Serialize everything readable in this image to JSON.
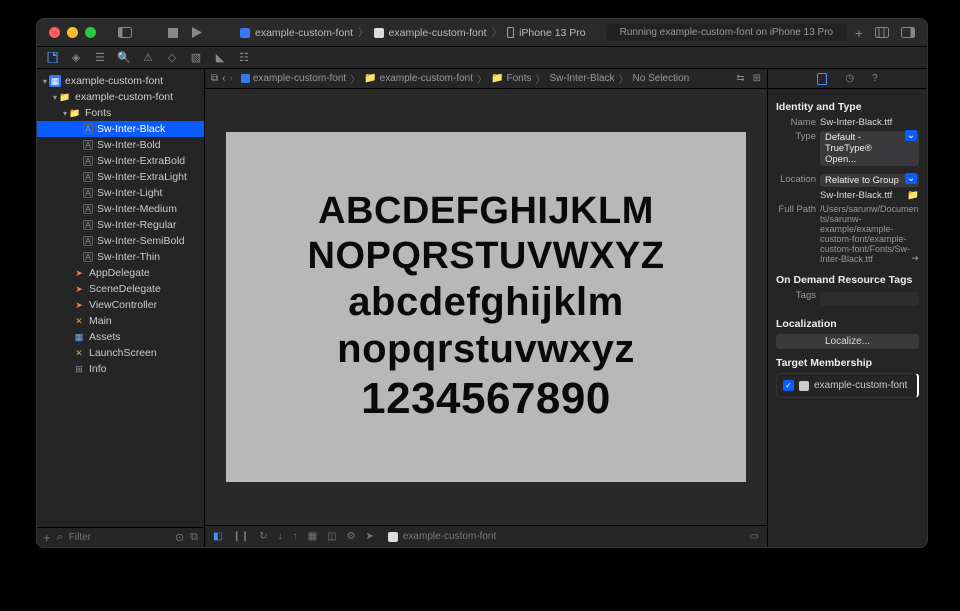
{
  "titlebar": {
    "scheme": "example-custom-font",
    "target_app": "example-custom-font",
    "device": "iPhone 13 Pro",
    "status": "Running example-custom-font on iPhone 13 Pro"
  },
  "navigator": {
    "project": "example-custom-font",
    "group": "example-custom-font",
    "fonts_folder": "Fonts",
    "fonts": [
      "Sw-Inter-Black",
      "Sw-Inter-Bold",
      "Sw-Inter-ExtraBold",
      "Sw-Inter-ExtraLight",
      "Sw-Inter-Light",
      "Sw-Inter-Medium",
      "Sw-Inter-Regular",
      "Sw-Inter-SemiBold",
      "Sw-Inter-Thin"
    ],
    "others": [
      {
        "label": "AppDelegate",
        "icon": "swift"
      },
      {
        "label": "SceneDelegate",
        "icon": "swift"
      },
      {
        "label": "ViewController",
        "icon": "swift"
      },
      {
        "label": "Main",
        "icon": "story"
      },
      {
        "label": "Assets",
        "icon": "asset"
      },
      {
        "label": "LaunchScreen",
        "icon": "story"
      },
      {
        "label": "Info",
        "icon": "plist"
      }
    ],
    "selected": "Sw-Inter-Black",
    "filter_placeholder": "Filter"
  },
  "jumpbar": {
    "items": [
      "example-custom-font",
      "example-custom-font",
      "Fonts",
      "Sw-Inter-Black",
      "No Selection"
    ]
  },
  "preview": {
    "l1": "ABCDEFGHIJKLM",
    "l2": "NOPQRSTUVWXYZ",
    "l3": "abcdefghijklm",
    "l4": "nopqrstuvwxyz",
    "l5": "1234567890"
  },
  "debugbar": {
    "process": "example-custom-font"
  },
  "inspector": {
    "identity_header": "Identity and Type",
    "name_label": "Name",
    "name_value": "Sw-Inter-Black.ttf",
    "type_label": "Type",
    "type_value": "Default - TrueType® Open...",
    "location_label": "Location",
    "location_value": "Relative to Group",
    "location_file": "Sw-Inter-Black.ttf",
    "fullpath_label": "Full Path",
    "fullpath_value": "/Users/sarunw/Documents/sarunw-example/example-custom-font/example-custom-font/Fonts/Sw-Inter-Black.ttf",
    "odr_header": "On Demand Resource Tags",
    "tags_label": "Tags",
    "loc_header": "Localization",
    "localize_btn": "Localize...",
    "tm_header": "Target Membership",
    "tm_target": "example-custom-font"
  }
}
